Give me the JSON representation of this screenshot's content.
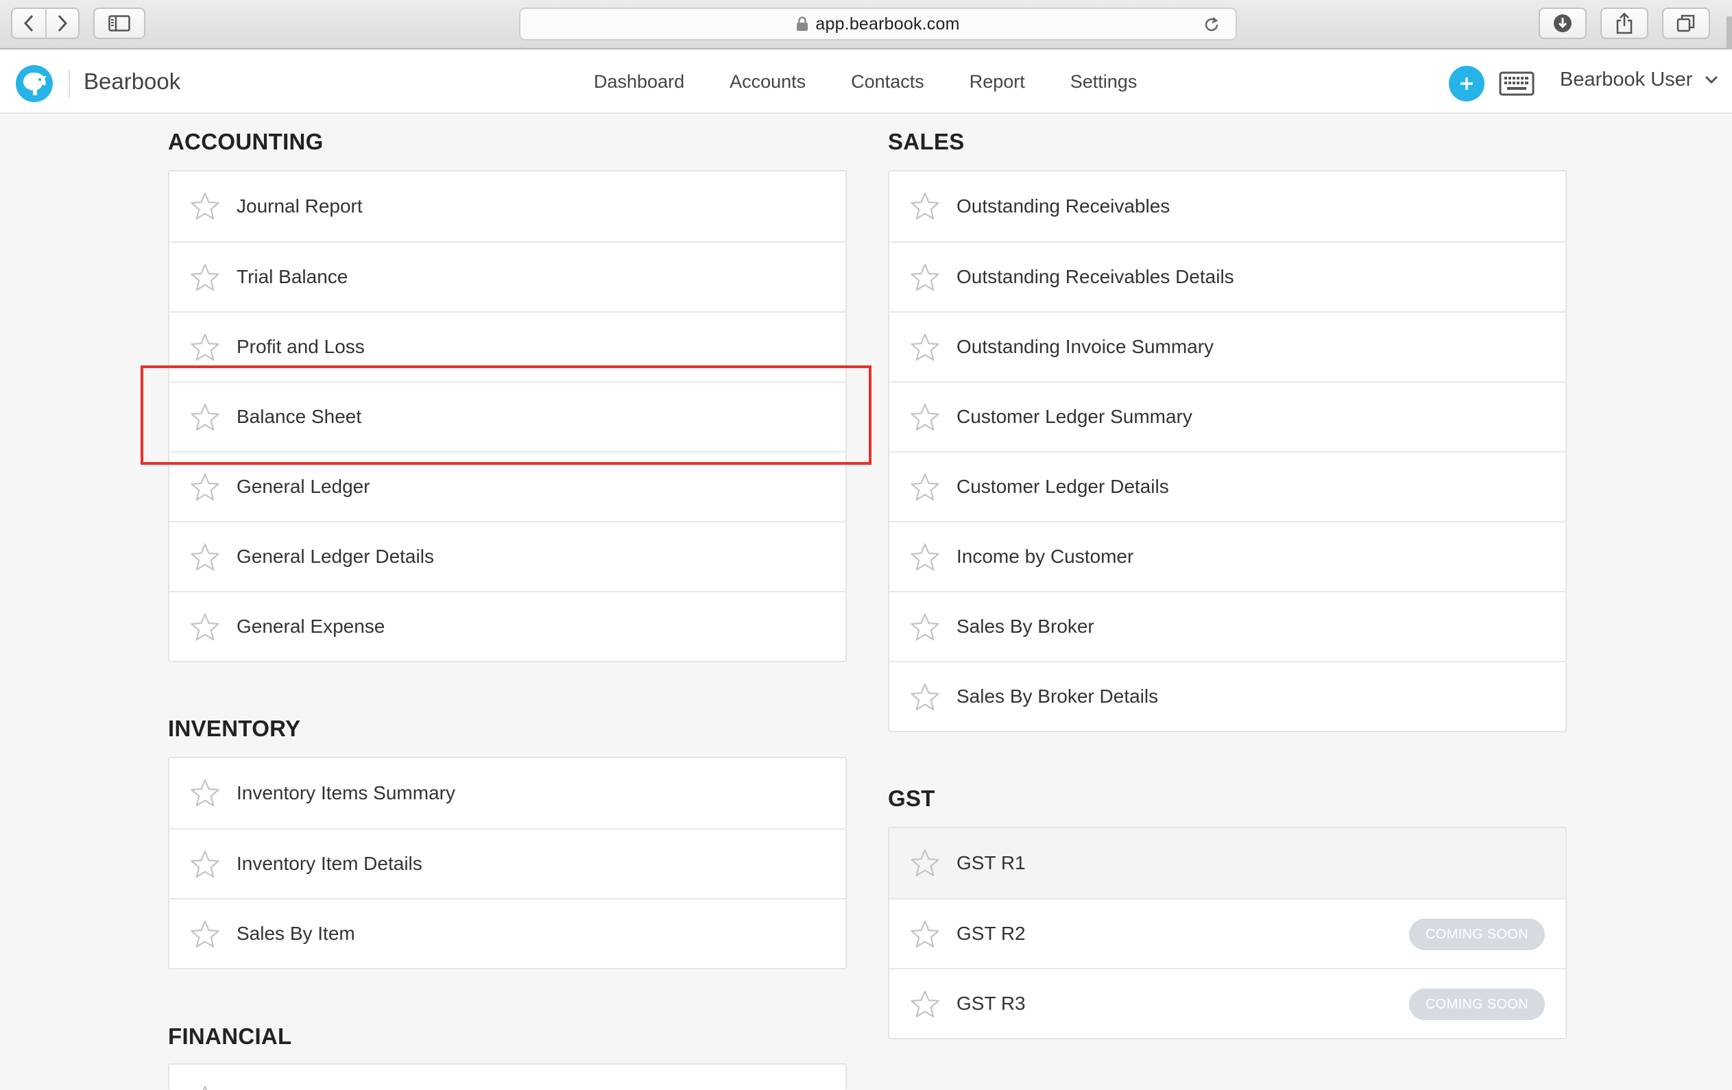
{
  "browser": {
    "url": "app.bearbook.com"
  },
  "header": {
    "brand": "Bearbook",
    "nav": [
      "Dashboard",
      "Accounts",
      "Contacts",
      "Report",
      "Settings"
    ],
    "add_label": "+",
    "user": "Bearbook User",
    "accent_color": "#26b4e8"
  },
  "sections": {
    "accounting": {
      "title": "ACCOUNTING",
      "items": [
        "Journal Report",
        "Trial Balance",
        "Profit and Loss",
        "Balance Sheet",
        "General Ledger",
        "General Ledger Details",
        "General Expense"
      ]
    },
    "inventory": {
      "title": "INVENTORY",
      "items": [
        "Inventory Items Summary",
        "Inventory Item Details",
        "Sales By Item"
      ]
    },
    "financial": {
      "title": "FINANCIAL"
    },
    "sales": {
      "title": "SALES",
      "items": [
        "Outstanding Receivables",
        "Outstanding Receivables Details",
        "Outstanding Invoice Summary",
        "Customer Ledger Summary",
        "Customer Ledger Details",
        "Income by Customer",
        "Sales By Broker",
        "Sales By Broker Details"
      ]
    },
    "gst": {
      "title": "GST",
      "items": [
        "GST R1",
        "GST R2",
        "GST R3"
      ],
      "badge": "COMING SOON"
    }
  },
  "annotation": {
    "highlighted_item": "Balance Sheet",
    "color": "#e8312d"
  }
}
